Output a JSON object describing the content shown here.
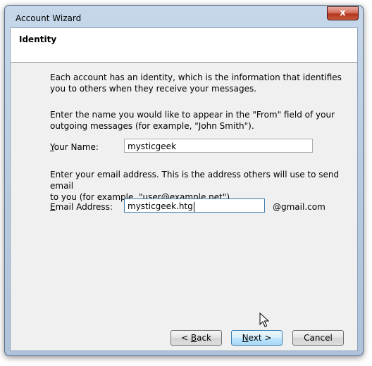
{
  "window": {
    "title": "Account Wizard",
    "close_glyph": "x"
  },
  "header": {
    "title": "Identity"
  },
  "intro": {
    "line1": "Each account has an identity, which is the information that identifies",
    "line2": "you to others when they receive your messages."
  },
  "name_section": {
    "line1": "Enter the name you would like to appear in the \"From\" field of your",
    "line2": "outgoing messages (for example, \"John Smith\").",
    "label_accel": "Y",
    "label_rest": "our Name:",
    "value": "mysticgeek"
  },
  "email_section": {
    "line1": "Enter your email address. This is the address others will use to send email",
    "line2": "to you (for example, \"user@example.net\").",
    "label_accel": "E",
    "label_rest": "mail Address:",
    "value": "mysticgeek.htg",
    "suffix": "@gmail.com"
  },
  "buttons": {
    "back_pre": "< ",
    "back_accel": "B",
    "back_rest": "ack",
    "next_accel": "N",
    "next_rest": "ext >",
    "cancel": "Cancel"
  },
  "icons": {
    "close": "close-icon",
    "pointer": "mouse-pointer-icon"
  }
}
